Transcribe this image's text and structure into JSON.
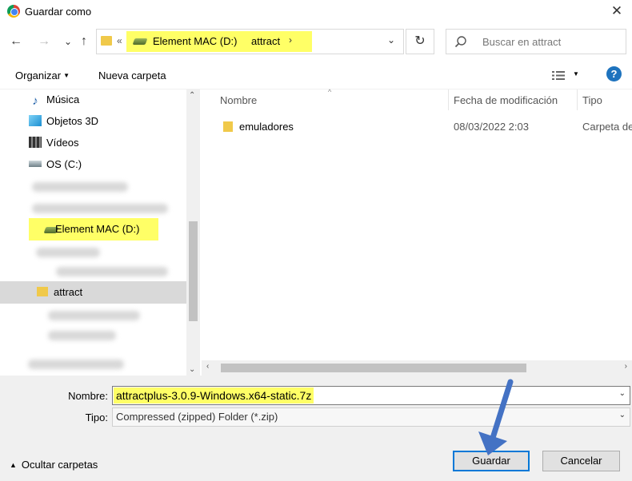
{
  "window": {
    "title": "Guardar como",
    "close_glyph": "✕"
  },
  "nav": {
    "back_glyph": "←",
    "forward_glyph": "→",
    "recent_glyph": "⌄",
    "up_glyph": "↑",
    "address": {
      "overflow_chevron": "«",
      "segments": [
        "Element MAC (D:)",
        "attract"
      ],
      "separator": "›",
      "dropdown_glyph": "⌄"
    },
    "refresh_glyph": "↻",
    "search": {
      "placeholder": "Buscar en attract",
      "icon": "search-icon"
    }
  },
  "toolbar": {
    "organize_label": "Organizar",
    "organize_arrow": "▼",
    "new_folder_label": "Nueva carpeta",
    "view_arrow": "▼",
    "help_glyph": "?"
  },
  "sidebar": {
    "items": [
      {
        "label": "Música",
        "icon": "music-icon"
      },
      {
        "label": "Objetos 3D",
        "icon": "cube-icon"
      },
      {
        "label": "Vídeos",
        "icon": "film-icon"
      },
      {
        "label": "OS (C:)",
        "icon": "drive-icon"
      }
    ],
    "highlighted_drive": "Element MAC (D:)",
    "selected_folder": "attract",
    "scroll_up": "⌃",
    "scroll_down": "⌄"
  },
  "files": {
    "columns": [
      "Nombre",
      "Fecha de modificación",
      "Tipo"
    ],
    "sort_arrow": "^",
    "rows": [
      {
        "name": "emuladores",
        "date": "08/03/2022 2:03",
        "type": "Carpeta de"
      }
    ],
    "hscroll_left": "‹",
    "hscroll_right": "›"
  },
  "form": {
    "name_label": "Nombre:",
    "name_value": "attractplus-3.0.9-Windows.x64-static.7z",
    "type_label": "Tipo:",
    "type_value": "Compressed (zipped) Folder (*.zip)",
    "dropdown_glyph": "⌄"
  },
  "footer": {
    "hide_folders_label": "Ocultar carpetas",
    "hide_arrow": "▲",
    "save_label": "Guardar",
    "cancel_label": "Cancelar"
  },
  "colors": {
    "highlight": "#ffff66",
    "accent": "#0078d7",
    "annotation_arrow": "#4472c4"
  }
}
